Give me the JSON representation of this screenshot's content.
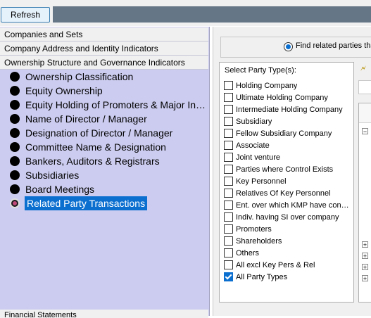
{
  "toolbar": {
    "refresh_label": "Refresh"
  },
  "sections": {
    "companies": "Companies and Sets",
    "address": "Company Address and Identity Indicators",
    "ownership": "Ownership Structure and Governance Indicators",
    "financial": "Financial Statements"
  },
  "menu_items": [
    "Ownership Classification",
    "Equity Ownership",
    "Equity Holding of Promoters & Major Inve…",
    "Name of Director / Manager",
    "Designation of Director / Manager",
    "Committee Name & Designation",
    "Bankers, Auditors & Registrars",
    "Subsidiaries",
    "Board Meetings",
    "Related Party Transactions"
  ],
  "selected_item": "Related Party Transactions",
  "right": {
    "radio_label": "Find related parties tha",
    "party_title": "Select Party Type(s):",
    "party_types": [
      {
        "label": "Holding Company",
        "checked": false
      },
      {
        "label": "Ultimate Holding Company",
        "checked": false
      },
      {
        "label": "Intermediate Holding Company",
        "checked": false
      },
      {
        "label": "Subsidiary",
        "checked": false
      },
      {
        "label": "Fellow Subsidiary Company",
        "checked": false
      },
      {
        "label": "Associate",
        "checked": false
      },
      {
        "label": "Joint venture",
        "checked": false
      },
      {
        "label": "Parties where Control Exists",
        "checked": false
      },
      {
        "label": "Key Personnel",
        "checked": false
      },
      {
        "label": "Relatives Of Key Personnel",
        "checked": false
      },
      {
        "label": "Ent. over which KMP have contr…",
        "checked": false
      },
      {
        "label": "Indiv. having SI over company",
        "checked": false
      },
      {
        "label": "Promoters",
        "checked": false
      },
      {
        "label": "Shareholders",
        "checked": false
      },
      {
        "label": "Others",
        "checked": false
      },
      {
        "label": "All excl Key Pers & Rel",
        "checked": false
      },
      {
        "label": "All Party Types",
        "checked": true
      }
    ],
    "tree_glyphs": {
      "collapse": "−",
      "expand": "+"
    }
  },
  "colors": {
    "selection": "#0b6fd0",
    "panel": "#ccccf0",
    "toolstrip": "#657686"
  }
}
